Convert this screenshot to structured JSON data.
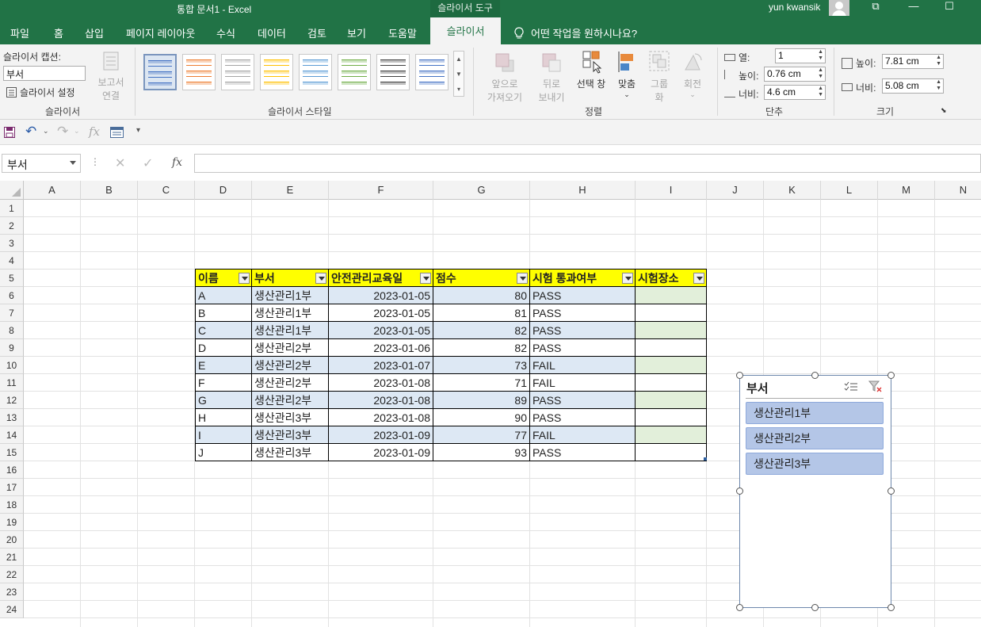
{
  "window": {
    "doc_title": "통합 문서1  -  Excel",
    "context_tool": "슬라이서 도구",
    "user": "yun kwansik",
    "controls": [
      "⧉",
      "—",
      "☐"
    ]
  },
  "tabs": {
    "file": "파일",
    "home": "홈",
    "insert": "삽입",
    "layout": "페이지 레이아웃",
    "formulas": "수식",
    "data": "데이터",
    "review": "검토",
    "view": "보기",
    "help": "도움말",
    "slicer": "슬라이서",
    "tellme": "어떤 작업을 원하시나요?"
  },
  "ribbon": {
    "slicer_caption_label": "슬라이서 캡션:",
    "slicer_caption_value": "부서",
    "slicer_settings": "슬라이서 설정",
    "report_conn_1": "보고서",
    "report_conn_2": "연결",
    "group_slicer": "슬라이서",
    "group_styles": "슬라이서 스타일",
    "bring_forward_1": "앞으로",
    "bring_forward_2": "가져오기",
    "send_backward_1": "뒤로",
    "send_backward_2": "보내기",
    "selection_pane": "선택 창",
    "align": "맞춤",
    "group_btn_1": "그룹",
    "group_btn_2": "화",
    "rotate": "회전",
    "group_arrange": "정렬",
    "cols_label": "열:",
    "cols_value": "1",
    "btn_height_label": "높이:",
    "btn_height_value": "0.76 cm",
    "btn_width_label": "너비:",
    "btn_width_value": "4.6 cm",
    "group_buttons": "단추",
    "height_label": "높이:",
    "height_value": "7.81 cm",
    "width_label": "너비:",
    "width_value": "5.08 cm",
    "group_size": "크기",
    "style_colors": [
      "#4472c4",
      "#ed7d31",
      "#a5a5a5",
      "#ffc000",
      "#5b9bd5",
      "#70ad47",
      "#404040",
      "#4472c4"
    ]
  },
  "namebox": "부서",
  "columns": [
    "A",
    "B",
    "C",
    "D",
    "E",
    "F",
    "G",
    "H",
    "I",
    "J",
    "K",
    "L",
    "M",
    "N"
  ],
  "rows": [
    "1",
    "2",
    "3",
    "4",
    "5",
    "6",
    "7",
    "8",
    "9",
    "10",
    "11",
    "12",
    "13",
    "14",
    "15",
    "16",
    "17",
    "18",
    "19",
    "20",
    "21",
    "22",
    "23",
    "24"
  ],
  "table": {
    "headers": [
      "이름",
      "부서",
      "안전관리교육일",
      "점수",
      "시험 통과여부",
      "시험장소"
    ],
    "rows": [
      [
        "A",
        "생산관리1부",
        "2023-01-05",
        "80",
        "PASS",
        ""
      ],
      [
        "B",
        "생산관리1부",
        "2023-01-05",
        "81",
        "PASS",
        ""
      ],
      [
        "C",
        "생산관리1부",
        "2023-01-05",
        "82",
        "PASS",
        ""
      ],
      [
        "D",
        "생산관리2부",
        "2023-01-06",
        "82",
        "PASS",
        ""
      ],
      [
        "E",
        "생산관리2부",
        "2023-01-07",
        "73",
        "FAIL",
        ""
      ],
      [
        "F",
        "생산관리2부",
        "2023-01-08",
        "71",
        "FAIL",
        ""
      ],
      [
        "G",
        "생산관리2부",
        "2023-01-08",
        "89",
        "PASS",
        ""
      ],
      [
        "H",
        "생산관리3부",
        "2023-01-08",
        "90",
        "PASS",
        ""
      ],
      [
        "I",
        "생산관리3부",
        "2023-01-09",
        "77",
        "FAIL",
        ""
      ],
      [
        "J",
        "생산관리3부",
        "2023-01-09",
        "93",
        "PASS",
        ""
      ]
    ]
  },
  "slicer": {
    "title": "부서",
    "items": [
      "생산관리1부",
      "생산관리2부",
      "생산관리3부"
    ]
  }
}
